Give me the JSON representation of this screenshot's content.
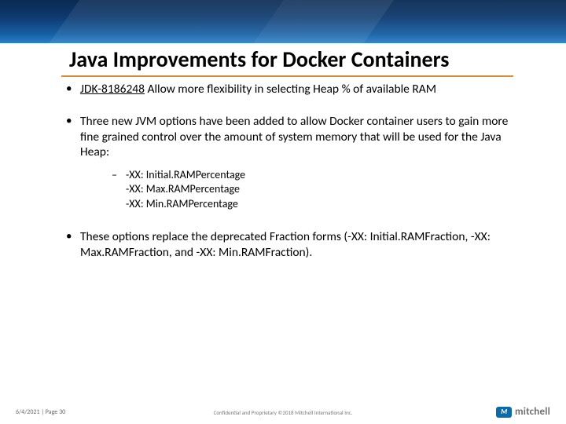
{
  "title": "Java Improvements for Docker Containers",
  "bullets": {
    "b1": {
      "link": "JDK-8186248",
      "rest": " Allow more flexibility in selecting Heap % of available RAM"
    },
    "b2": "Three new JVM options have been added to allow Docker container users to gain more fine grained control over the amount of system memory that will be used for the Java Heap:",
    "sub": {
      "line1": "-XX: Initial.RAMPercentage",
      "line2": "-XX: Max.RAMPercentage",
      "line3": "-XX: Min.RAMPercentage"
    },
    "b3": "These options replace the deprecated Fraction forms (-XX: Initial.RAMFraction, -XX: Max.RAMFraction, and -XX: Min.RAMFraction)."
  },
  "footer": {
    "left": "6/4/2021  |  Page 30",
    "center": "Confidential and Proprietary ©2018 Mitchell International Inc.",
    "logo_badge": "M",
    "logo_text": "mitchell"
  }
}
